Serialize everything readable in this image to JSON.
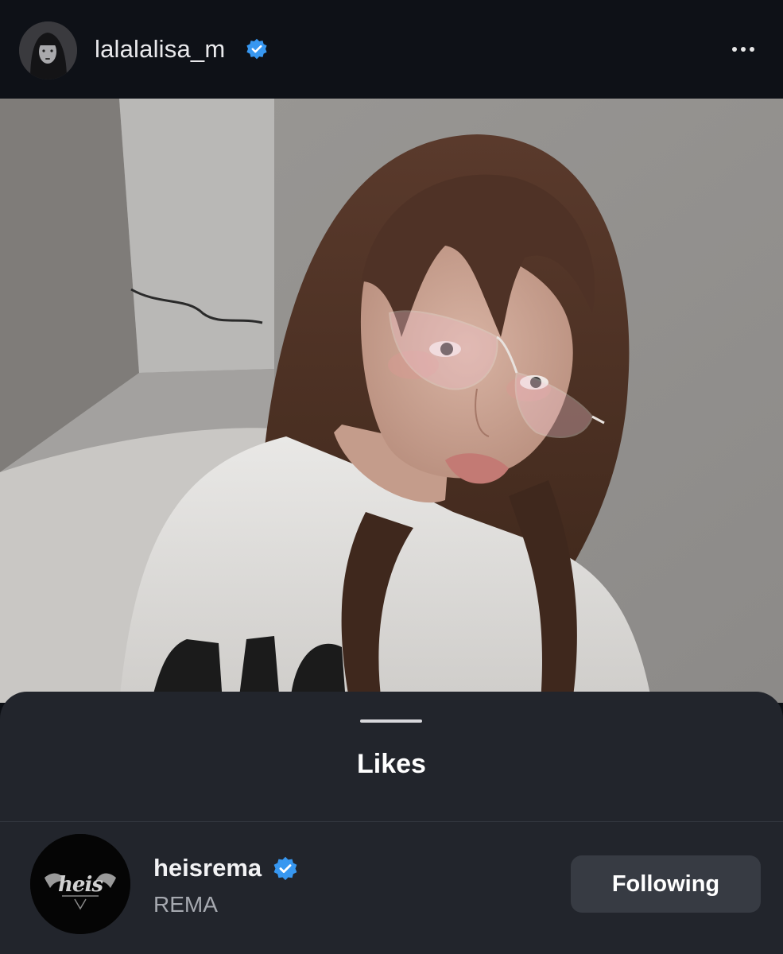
{
  "post": {
    "author": {
      "username": "lalalalisa_m",
      "verified": true,
      "avatar": "profile-avatar"
    },
    "more_icon": "more-horizontal-icon",
    "photo": "selfie-photo"
  },
  "likes_sheet": {
    "title": "Likes",
    "users": [
      {
        "username": "heisrema",
        "full_name": "REMA",
        "verified": true,
        "button_label": "Following",
        "avatar": "heis-logo-avatar"
      }
    ]
  },
  "colors": {
    "verified_blue": "#3797f0",
    "sheet_background": "#22252c",
    "following_button": "#373b43",
    "header_background": "#0e1117"
  }
}
